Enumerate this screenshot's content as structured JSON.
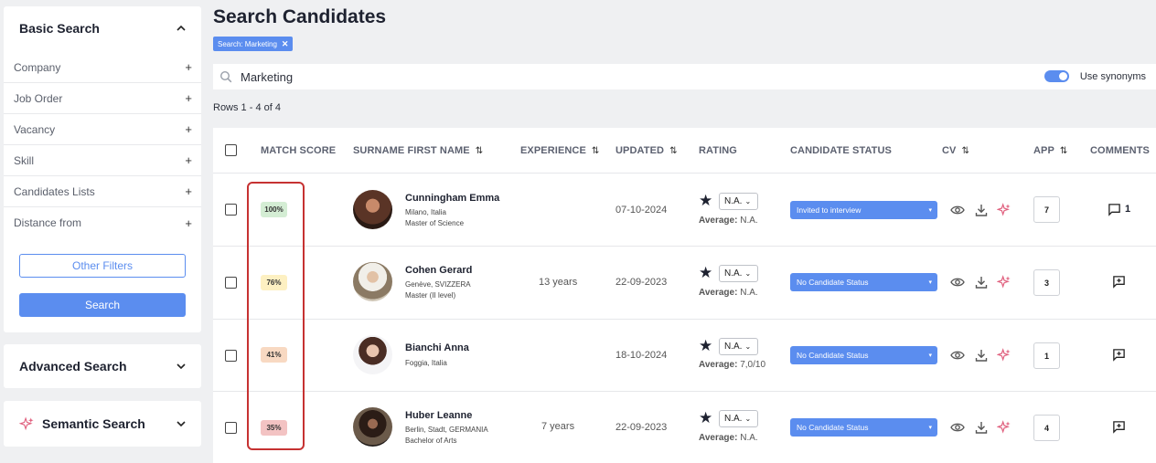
{
  "sidebar": {
    "basic_search": {
      "title": "Basic Search",
      "filters": [
        "Company",
        "Job Order",
        "Vacancy",
        "Skill",
        "Candidates Lists",
        "Distance from"
      ],
      "other_filters_label": "Other Filters",
      "search_label": "Search"
    },
    "advanced_search": {
      "title": "Advanced Search"
    },
    "semantic_search": {
      "title": "Semantic Search"
    }
  },
  "main": {
    "title": "Search Candidates",
    "chip_label": "Search: Marketing",
    "search_value": "Marketing",
    "use_synonyms_label": "Use synonyms",
    "use_synonyms_on": true,
    "rows_label": "Rows 1 - 4 of 4"
  },
  "table": {
    "headers": {
      "match_score": "MATCH SCORE",
      "name": "SURNAME FIRST NAME",
      "experience": "EXPERIENCE",
      "updated": "UPDATED",
      "rating": "RATING",
      "candidate_status": "CANDIDATE STATUS",
      "cv": "CV",
      "app": "APP",
      "comments": "COMMENTS"
    },
    "average_label": "Average:",
    "rows": [
      {
        "score": "100%",
        "score_color": "#d4edd4",
        "name": "Cunningham Emma",
        "location": "Milano, Italia",
        "degree": "Master of Science",
        "experience": "",
        "updated": "07-10-2024",
        "rating_select": "N.A.",
        "average": "N.A.",
        "status": "Invited to interview",
        "app": "7",
        "comments": "1"
      },
      {
        "score": "76%",
        "score_color": "#fdf0c2",
        "name": "Cohen Gerard",
        "location": "Genève, SVIZZERA",
        "degree": "Master (II level)",
        "experience": "13 years",
        "updated": "22-09-2023",
        "rating_select": "N.A.",
        "average": "N.A.",
        "status": "No Candidate Status",
        "app": "3",
        "comments": ""
      },
      {
        "score": "41%",
        "score_color": "#f8d9c2",
        "name": "Bianchi Anna",
        "location": "Foggia, Italia",
        "degree": "",
        "experience": "",
        "updated": "18-10-2024",
        "rating_select": "N.A.",
        "average": "7,0/10",
        "status": "No Candidate Status",
        "app": "1",
        "comments": ""
      },
      {
        "score": "35%",
        "score_color": "#f3c3c3",
        "name": "Huber Leanne",
        "location": "Berlin, Stadt, GERMANIA",
        "degree": "Bachelor of Arts",
        "experience": "7 years",
        "updated": "22-09-2023",
        "rating_select": "N.A.",
        "average": "N.A.",
        "status": "No Candidate Status",
        "app": "4",
        "comments": ""
      }
    ]
  },
  "colors": {
    "accent": "#5b8def",
    "highlight": "#c63232",
    "sparkle": "#e0607e"
  }
}
